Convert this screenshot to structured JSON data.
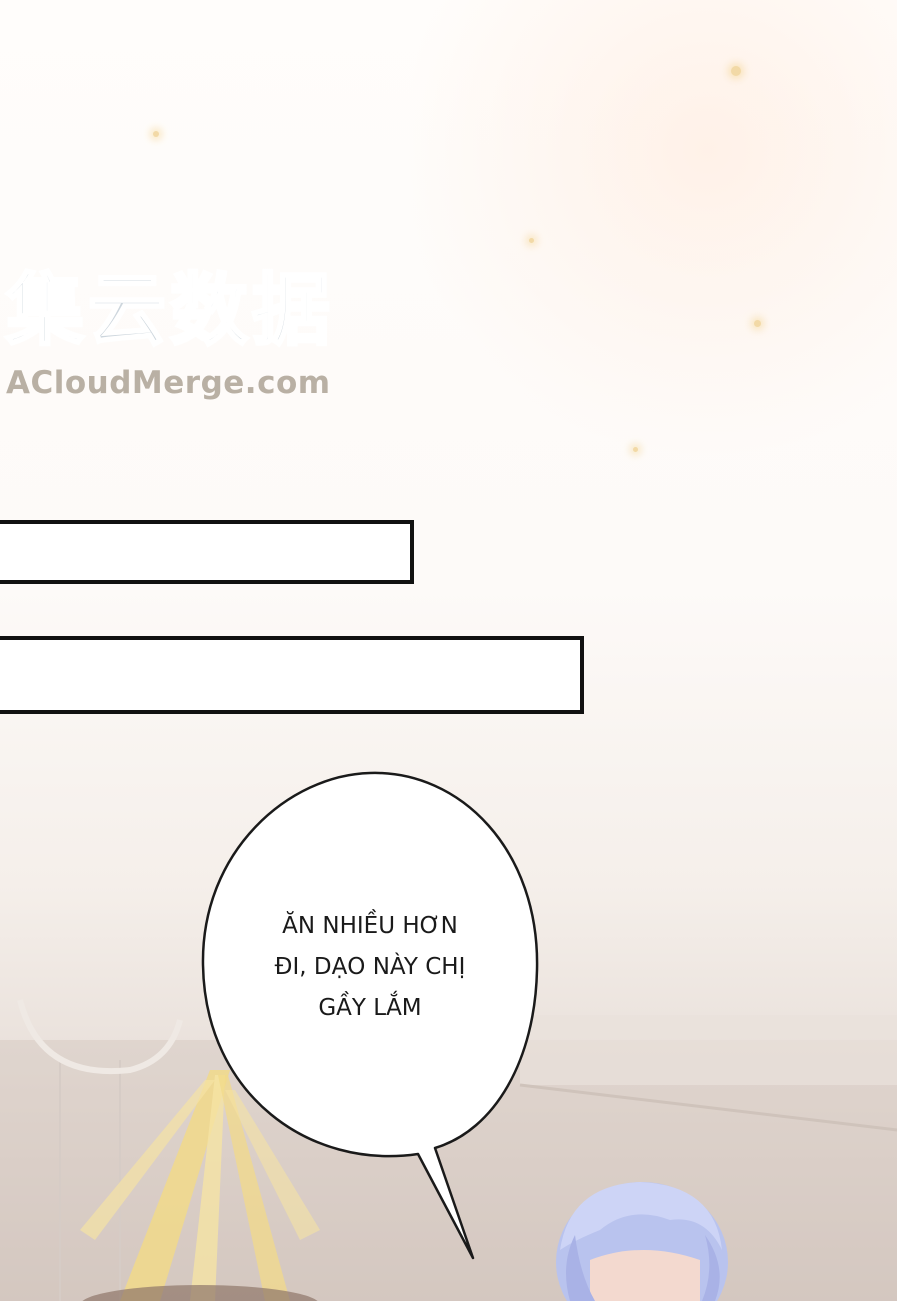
{
  "watermark": {
    "chinese": "集云数据",
    "site": "ACloudMerge.com"
  },
  "caption_boxes": [
    {
      "text": ""
    },
    {
      "text": ""
    }
  ],
  "speech_bubble": {
    "lines": [
      "ĂN NHIỀU HƠN",
      "ĐI, DẠO NÀY CHỊ",
      "GẦY LẮM"
    ]
  }
}
